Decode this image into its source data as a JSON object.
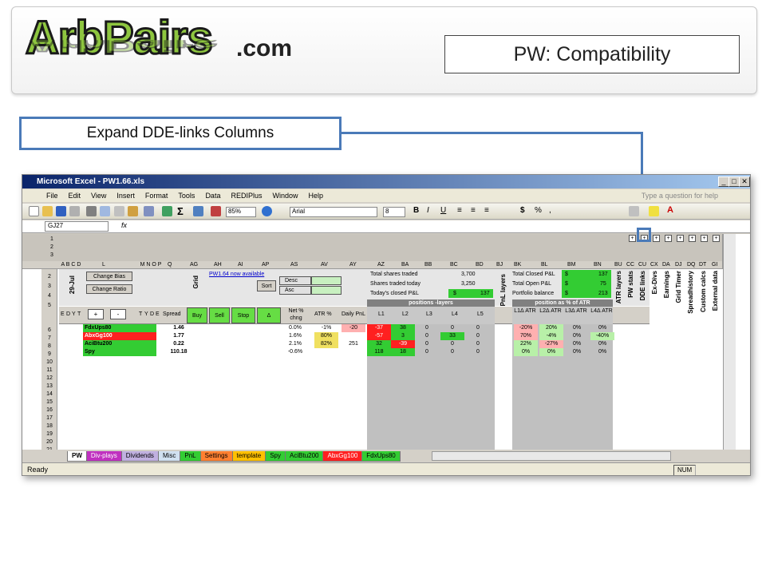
{
  "logo": {
    "name": "ArbPairs",
    "domain": ".com"
  },
  "slide_title": "PW: Compatibility",
  "callout": "Expand DDE-links Columns",
  "excel": {
    "window_title": "Microsoft Excel - PW1.66.xls",
    "menus": [
      "File",
      "Edit",
      "View",
      "Insert",
      "Format",
      "Tools",
      "Data",
      "REDIPlus",
      "Window",
      "Help"
    ],
    "help_prompt": "Type a question for help",
    "zoom": "85%",
    "font": "Arial",
    "font_size": "8",
    "name_box": "GJ27",
    "fx": "fx",
    "columns": [
      "A",
      "B",
      "C",
      "D",
      "L",
      "M",
      "N",
      "O",
      "P",
      "Q",
      "AG",
      "AH",
      "AI",
      "AP",
      "AS",
      "AV",
      "AY",
      "AZ",
      "BA",
      "BB",
      "BC",
      "BD",
      "BJ",
      "BK",
      "BL",
      "BM",
      "BN",
      "BU",
      "CC",
      "CU",
      "CX",
      "DA",
      "DJ",
      "DQ",
      "DT",
      "GI"
    ],
    "controls": {
      "change_bias": "Change Bias",
      "change_ratio": "Change Ratio",
      "date": "29-Jul",
      "grid": "Grid",
      "available": "PW1.64 now available",
      "sort": "Sort",
      "desc": "Desc",
      "asc": "Asc"
    },
    "stats": [
      {
        "label": "Total shares traded",
        "value": "3,700"
      },
      {
        "label": "Shares traded today",
        "value": "3,250"
      },
      {
        "label": "Today's closed P&L",
        "prefix": "$",
        "value": "137"
      }
    ],
    "pnl": [
      {
        "label": "Total Closed P&L",
        "prefix": "$",
        "value": "137"
      },
      {
        "label": "Total Open P&L",
        "prefix": "$",
        "value": "75"
      },
      {
        "label": "Portfolio balance",
        "prefix": "$",
        "value": "213"
      }
    ],
    "pnl_layers": "PnL layers",
    "vertical_headers": [
      "ATR layers",
      "PW stats",
      "DDE links",
      "Ex-Divs",
      "Earnings",
      "Grid Timer",
      "Spreadhistory",
      "Custom calcs",
      "External data"
    ],
    "group_headers": {
      "positions": "positions -layers",
      "position_atr": "position as % of ATR"
    },
    "header_row": [
      "E",
      "D",
      "Y",
      "T",
      "+",
      "-",
      "T",
      "Y",
      "D",
      "E",
      "Spread",
      "Buy",
      "Sell",
      "Stop",
      "Δ",
      "Net % chng",
      "ATR %",
      "Daily PnL",
      "L1",
      "L2",
      "L3",
      "L4",
      "L5",
      "L1Δ ATR",
      "L2Δ ATR",
      "L3Δ ATR",
      "L4Δ ATR"
    ],
    "rows": [
      {
        "num": "7",
        "name": "FdxUps80",
        "spread": "1.46",
        "net": "0.0%",
        "atr": "-1%",
        "daily": "-20",
        "L": [
          "-37",
          "38",
          "0",
          "0",
          "0"
        ],
        "LA": [
          "-20%",
          "20%",
          "0%",
          "0%"
        ]
      },
      {
        "num": "8",
        "name": "AbxGg100",
        "spread": "1.77",
        "net": "1.6%",
        "atr": "80%",
        "daily": "",
        "L": [
          "-57",
          "3",
          "0",
          "33",
          "0"
        ],
        "LA": [
          "70%",
          "-4%",
          "0%",
          "-40%"
        ]
      },
      {
        "num": "9",
        "name": "AciBtu200",
        "spread": "0.22",
        "net": "2.1%",
        "atr": "82%",
        "daily": "251",
        "L": [
          "32",
          "-39",
          "0",
          "0",
          "0"
        ],
        "LA": [
          "22%",
          "-27%",
          "0%",
          "0%"
        ]
      },
      {
        "num": "10",
        "name": "Spy",
        "spread": "110.18",
        "net": "-0.6%",
        "atr": "",
        "daily": "",
        "L": [
          "118",
          "18",
          "0",
          "0",
          "0"
        ],
        "LA": [
          "0%",
          "0%",
          "0%",
          "0%"
        ]
      }
    ],
    "row_numbers": [
      "1",
      "2",
      "3",
      "2",
      "3",
      "4",
      "5",
      "6",
      "7",
      "8",
      "9",
      "10",
      "11",
      "12",
      "13",
      "14",
      "15",
      "16",
      "17",
      "18",
      "19",
      "20",
      "21"
    ],
    "sheets": [
      "PW",
      "Div-plays",
      "Dividends",
      "Misc",
      "PnL",
      "Settings",
      "template",
      "Spy",
      "AciBtu200",
      "AbxGg100",
      "FdxUps80"
    ],
    "status": "Ready",
    "num": "NUM"
  },
  "colors": {
    "accent": "#4a7ab8",
    "green": "#33cc33",
    "red": "#ff2020",
    "pink": "#ffb0b0",
    "light_green": "#b8f0a8"
  }
}
